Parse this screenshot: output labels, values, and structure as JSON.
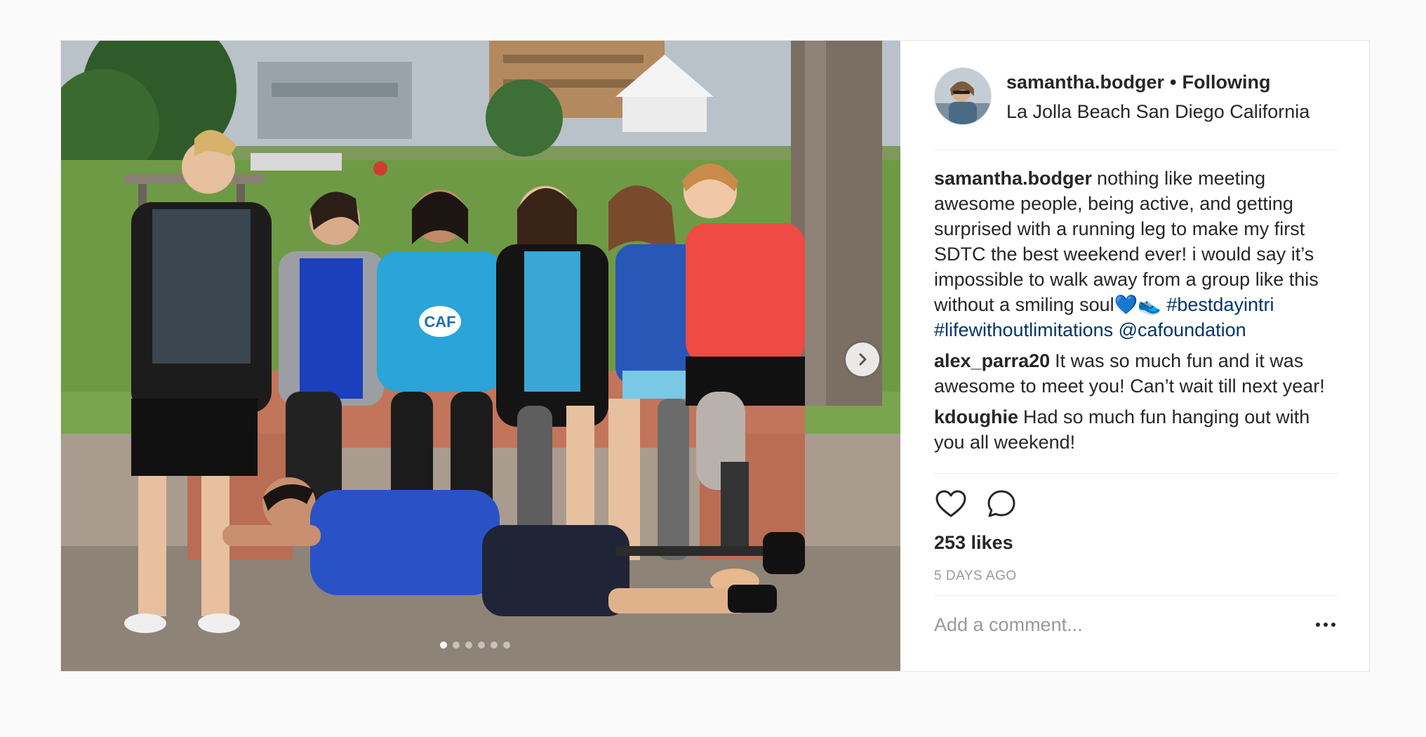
{
  "post": {
    "username": "samantha.bodger",
    "separator": "•",
    "follow_status": "Following",
    "location": "La Jolla Beach San Diego California",
    "likes": "253 likes",
    "time_ago": "5 DAYS AGO",
    "add_comment_placeholder": "Add a comment...",
    "carousel_page": 1,
    "carousel_total": 6
  },
  "comments": [
    {
      "author": "samantha.bodger",
      "text": "nothing like meeting awesome people, being active, and getting surprised with a running leg to make my first SDTC the best weekend ever! i would say it’s impossible to walk away from a group like this without a smiling soul💙👟",
      "hashtag1": "#bestdayintri",
      "hashtag2": "#lifewithoutlimitations",
      "mention": "@cafoundation"
    },
    {
      "author": "alex_parra20",
      "text": "It was so much fun and it was awesome to meet you! Can’t wait till next year!"
    },
    {
      "author": "kdoughie",
      "text": "Had so much fun hanging out with you all weekend!"
    }
  ],
  "photo": {
    "shirt_text": "CAF"
  },
  "colors": {
    "link": "#003569",
    "muted": "#999999",
    "text": "#262626",
    "border": "#e6e6e6"
  },
  "icons": {
    "like": "heart-outline-icon",
    "comment": "speech-bubble-icon",
    "next": "chevron-right-icon",
    "more": "ellipsis-icon"
  }
}
